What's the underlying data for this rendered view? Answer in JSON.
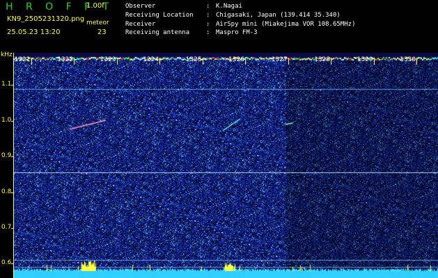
{
  "header": {
    "logo": "HROFFT",
    "version": "1.00f",
    "filename": "KN9_2505231320.png",
    "datetime": "25.05.23 13:20",
    "meteor_label": "meteor",
    "meteor_count": "23"
  },
  "info": [
    {
      "key": "Observer",
      "value": "K.Nagai"
    },
    {
      "key": "Receiving Location",
      "value": "Chigasaki, Japan (139.414 35.340)"
    },
    {
      "key": "Receiver",
      "value": "AirSpy mini (Miakejima VOR 108.65MHz)"
    },
    {
      "key": "Receiving antenna",
      "value": "Maspro FM-3"
    }
  ],
  "axes": {
    "y_unit": "kHz",
    "y_ticks": [
      "1.1",
      "1.0",
      "0.9",
      "0.8",
      "0.7",
      "0.6"
    ],
    "y_tick_values": [
      1.1,
      1.0,
      0.9,
      0.8,
      0.7,
      0.6
    ],
    "x_ticks": [
      "1321",
      "1322",
      "1323",
      "1324",
      "1325",
      "1326",
      "1327",
      "1328",
      "1329",
      "1330"
    ],
    "y_range_khz": [
      0.56,
      1.19
    ],
    "x_range_min": [
      1320.6,
      1330.5
    ]
  },
  "colors": {
    "label": "#ffff33",
    "logo": "#2ad12a",
    "background_noise": "#1c2db0",
    "signal": "#33ddff"
  }
}
